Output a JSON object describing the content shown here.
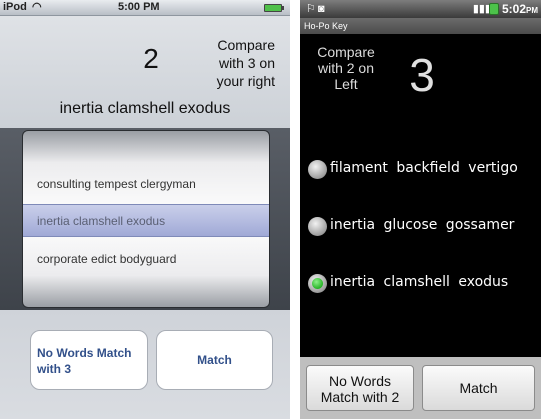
{
  "ipod": {
    "status": {
      "carrier": "iPod",
      "time": "5:00 PM",
      "wifi_icon": "wifi-icon",
      "battery_icon": "battery-icon"
    },
    "compare_number": "2",
    "compare_text": [
      "Compare",
      "with 3 on",
      "your right"
    ],
    "target_words": "inertia clamshell exodus",
    "picker": {
      "rows": [
        "consulting tempest clergyman",
        "inertia clamshell exodus",
        "corporate edict bodyguard"
      ],
      "selected_index": 1
    },
    "buttons": {
      "no_match_line1": "No Words Match",
      "no_match_line2": "with 3",
      "match": "Match"
    }
  },
  "android": {
    "status": {
      "time": "5:02",
      "ampm": "PM"
    },
    "title": "Ho-Po Key",
    "compare_text": [
      "Compare",
      "with 2 on",
      "Left"
    ],
    "compare_number": "3",
    "options": [
      {
        "label": "filament backfield vertigo",
        "selected": false
      },
      {
        "label": "inertia glucose gossamer",
        "selected": false
      },
      {
        "label": "inertia clamshell exodus",
        "selected": true
      }
    ],
    "buttons": {
      "no_match_line1": "No Words",
      "no_match_line2": "Match with 2",
      "match": "Match"
    }
  }
}
